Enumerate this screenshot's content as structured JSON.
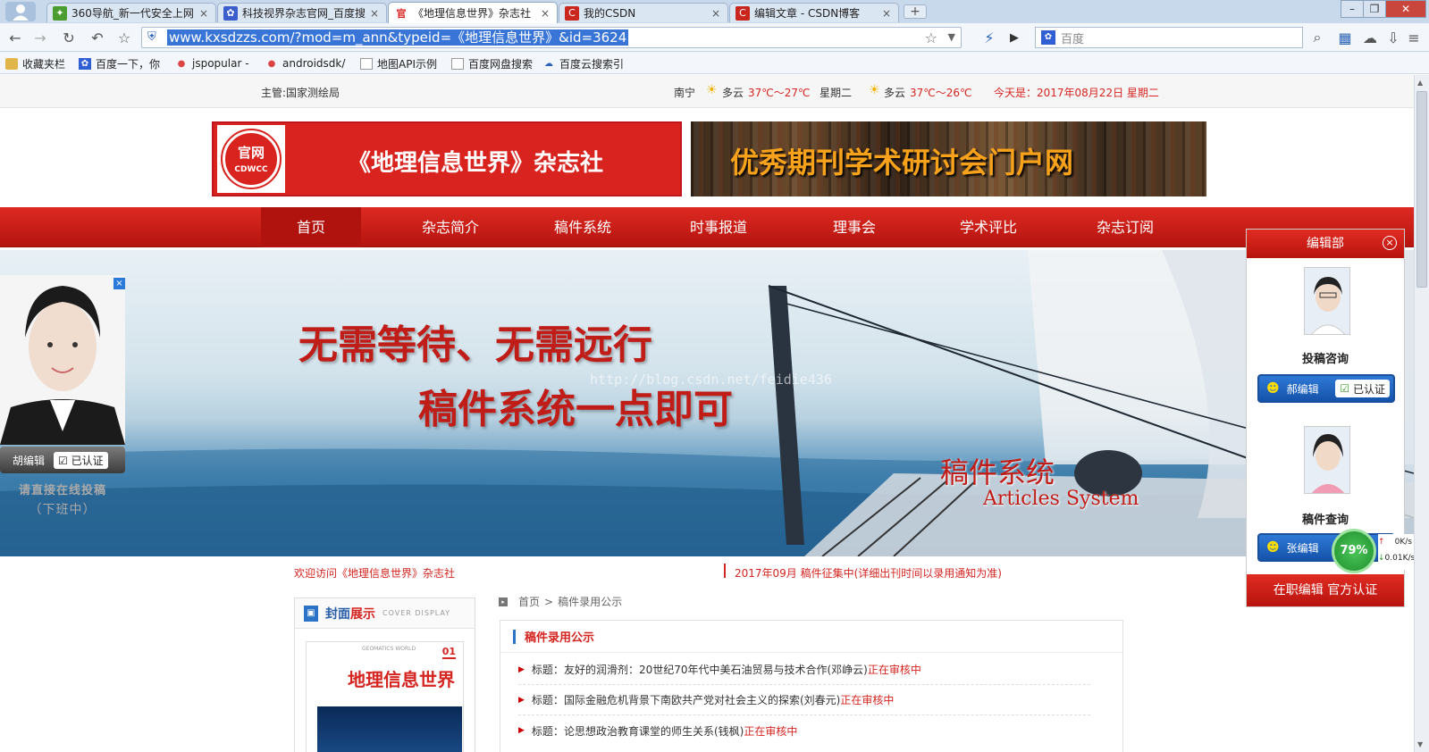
{
  "browser": {
    "tabs": [
      {
        "title": "360导航_新一代安全上网",
        "icon_color": "#4a9d2e",
        "icon_name": "360-icon",
        "active": false
      },
      {
        "title": "科技视界杂志官网_百度搜",
        "icon_color": "#3a5fcd",
        "icon_name": "baidu-paw-icon",
        "active": false
      },
      {
        "title": "《地理信息世界》杂志社",
        "icon_color": "#d9231f",
        "icon_name": "official-icon",
        "icon_text": "官",
        "active": true
      },
      {
        "title": "我的CSDN",
        "icon_color": "#c9261d",
        "icon_name": "csdn-icon",
        "icon_text": "C",
        "active": false
      },
      {
        "title": "编辑文章 - CSDN博客",
        "icon_color": "#c9261d",
        "icon_name": "csdn-icon",
        "icon_text": "C",
        "active": false
      }
    ],
    "url": "www.kxsdzzs.com/?mod=m_ann&typeid=《地理信息世界》&id=3624",
    "search_placeholder": "百度",
    "bookmarks": [
      "收藏夹栏",
      "百度一下，你",
      "jspopular -",
      "androidsdk/",
      "地图API示例",
      "百度网盘搜索",
      "百度云搜索引"
    ]
  },
  "site": {
    "sponsor": "主管:国家测绘局",
    "weather": {
      "city": "南宁",
      "today_cond": "多云",
      "today_temp": "37℃～27℃",
      "weekday": "星期二",
      "tomorrow_cond": "多云",
      "tomorrow_temp": "37℃～26℃",
      "date": "今天是：2017年08月22日 星期二"
    },
    "logo_badge": "官网",
    "logo_badge_sub": "CDWCC",
    "logo_title": "《地理信息世界》杂志社",
    "portal_title": "优秀期刊学术研讨会门户网",
    "menu": [
      "首页",
      "杂志简介",
      "稿件系统",
      "时事报道",
      "理事会",
      "学术评比",
      "杂志订阅"
    ],
    "banner": {
      "line1": "无需等待、无需远行",
      "line2": "稿件系统一点即可",
      "sys_cn": "稿件系统",
      "sys_en": "Articles System",
      "watermark": "http://blog.csdn.net/feidie436"
    },
    "welcome": "欢迎访问《地理信息世界》杂志社",
    "notice": "2017年09月 稿件征集中(详细出刊时间以录用通知为准)",
    "cover": {
      "title_a": "封面",
      "title_b": "展示",
      "title_en": "COVER DISPLAY",
      "mag_title": "地理信息世界",
      "mag_en": "GEOMATICS WORLD",
      "mag_no": "01"
    },
    "crumb": {
      "home": "首页",
      "sep": ">",
      "current": "稿件录用公示"
    },
    "list_title": "稿件录用公示",
    "list": [
      {
        "label": "标题：",
        "title": "友好的润滑剂：20世纪70年代中美石油贸易与技术合作(邓峥云)",
        "status": "正在审核中"
      },
      {
        "label": "标题：",
        "title": "国际金融危机背景下南欧共产党对社会主义的探索(刘春元)",
        "status": "正在审核中"
      },
      {
        "label": "标题：",
        "title": "论思想政治教育课堂的师生关系(钱枫)",
        "status": "正在审核中"
      }
    ]
  },
  "left_float": {
    "editor": "胡编辑",
    "verified": "已认证",
    "hint1": "请直接在线投稿",
    "hint2": "（下班中）"
  },
  "right_float": {
    "title": "编辑部",
    "person1_role": "投稿咨询",
    "person1_name": "郝编辑",
    "verified": "已认证",
    "person2_role": "稿件查询",
    "person2_name": "张编辑",
    "footer": "在职编辑  官方认证",
    "speed_pct": "79%",
    "speed_up": "0K/s",
    "speed_down": "0.01K/s"
  }
}
